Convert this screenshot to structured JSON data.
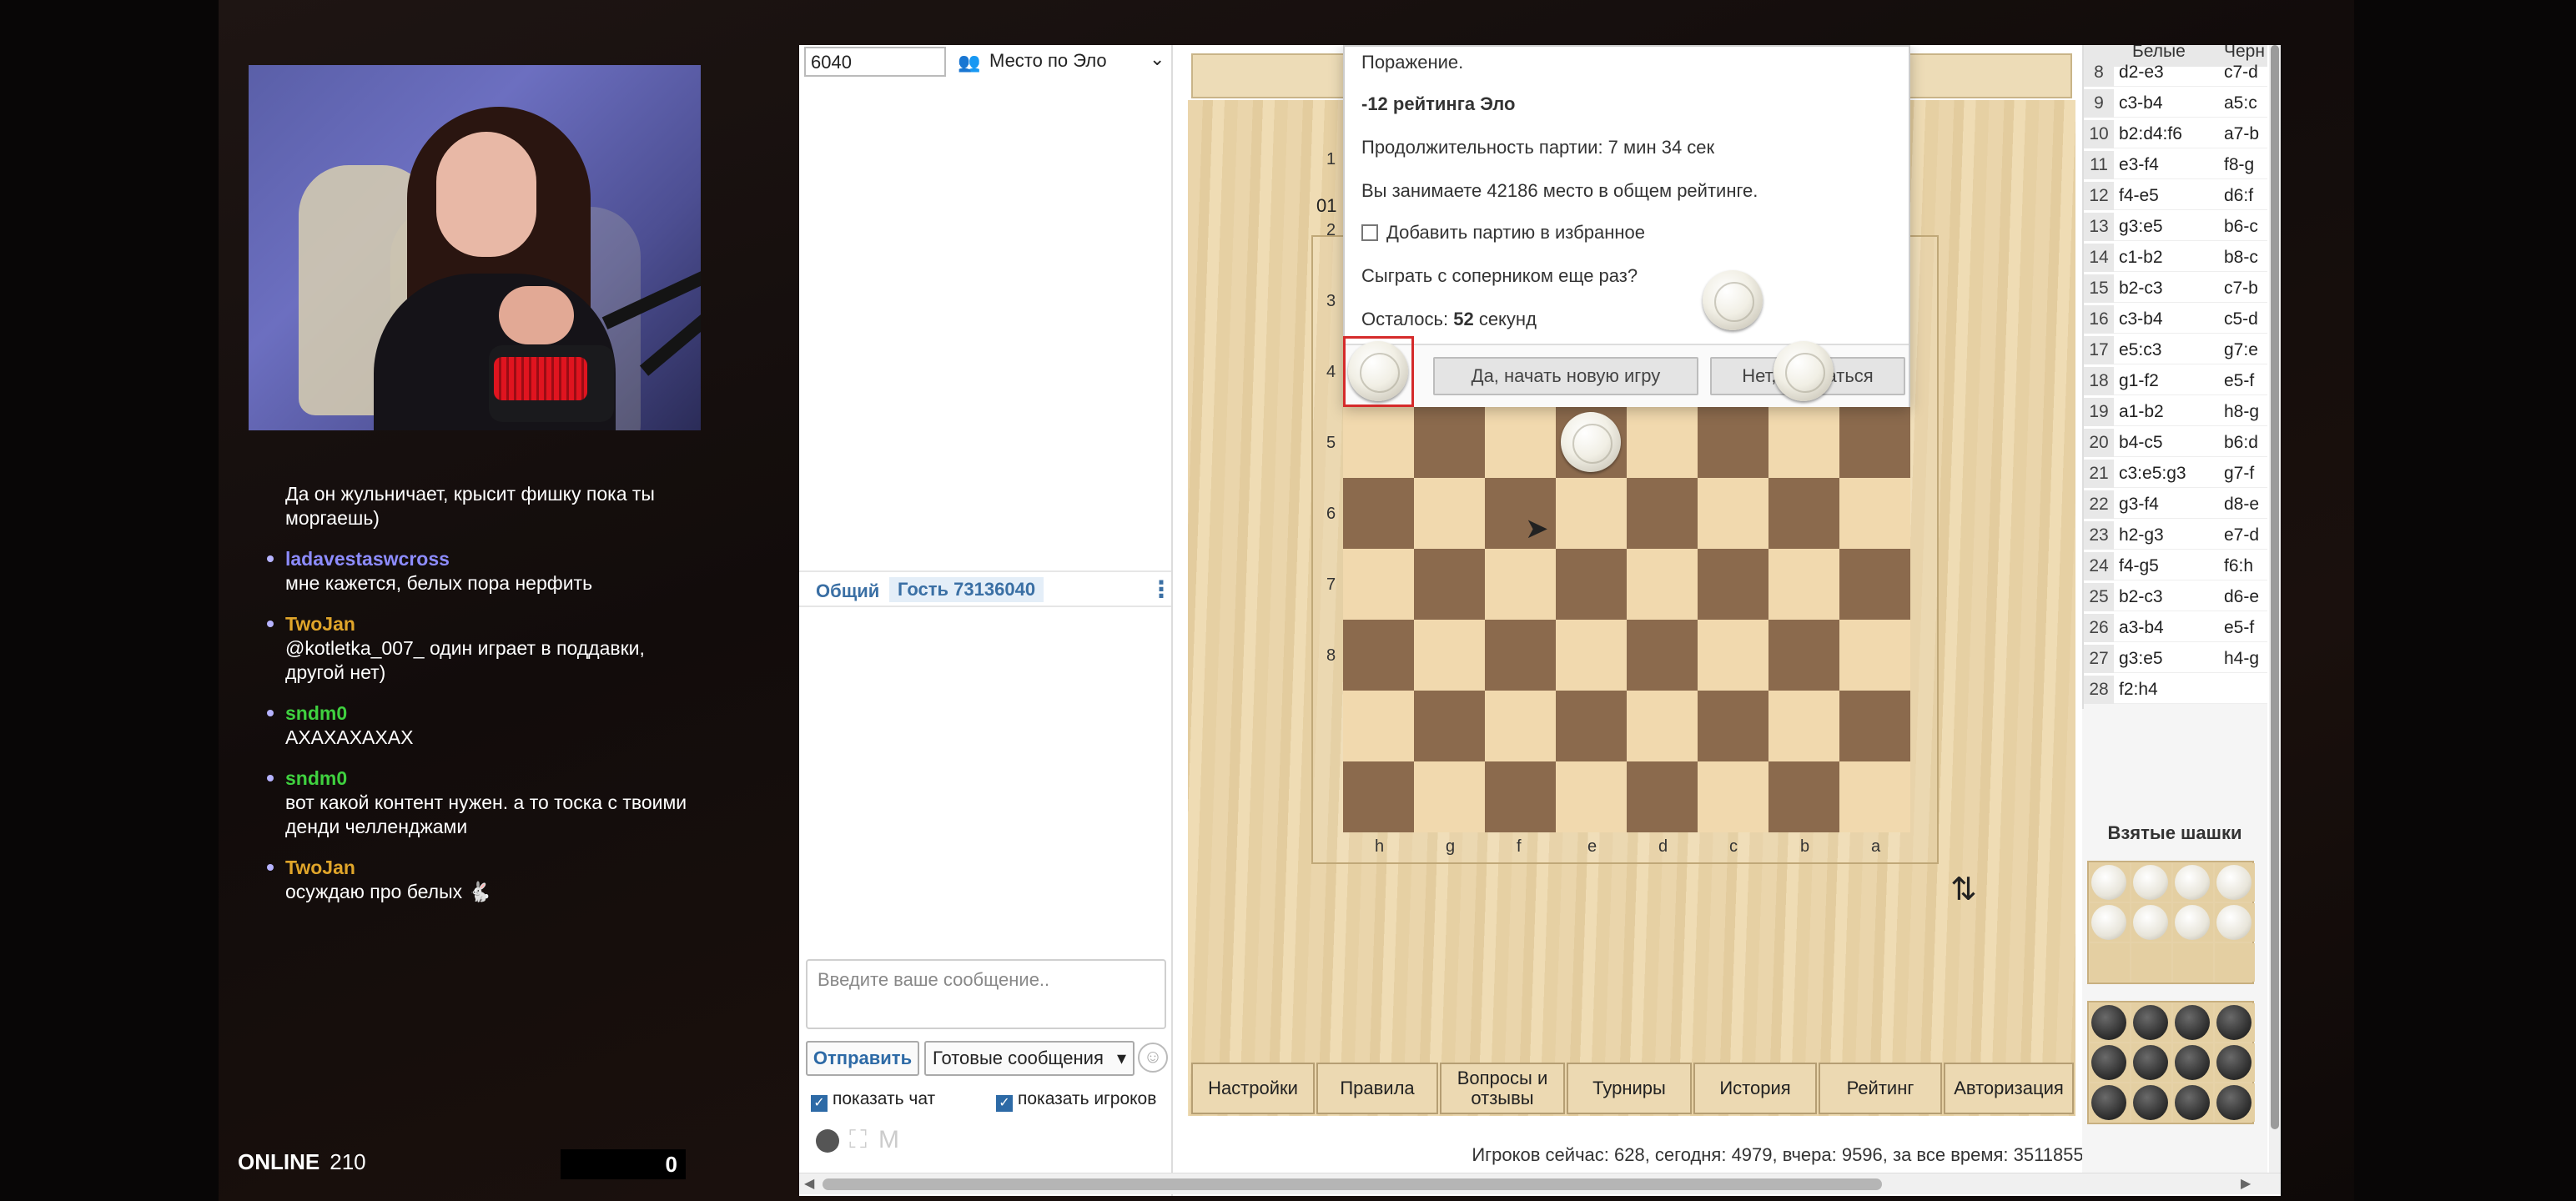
{
  "overlay": {
    "chat": [
      {
        "user": "",
        "text": "Да он жульничает, крысит фишку пока ты моргаешь)",
        "color": "#ffffff"
      },
      {
        "user": "ladavestaswcross",
        "text": "мне кажется, белых пора нерфить",
        "color": "#8d8cff"
      },
      {
        "user": "TwoJan",
        "text": "@kotletka_007_ один играет в поддавки, другой нет)",
        "color": "#e0a52a"
      },
      {
        "user": "sndm0",
        "text": "АХАХАХАХАХ",
        "color": "#3fd13f"
      },
      {
        "user": "sndm0",
        "text": "вот какой контент нужен. а то тоска с твоими денди челленджами",
        "color": "#3fd13f"
      },
      {
        "user": "TwoJan",
        "text": "осуждаю про белых 🐇",
        "color": "#e0a52a"
      }
    ],
    "online_label": "ONLINE",
    "online_count": "210",
    "counter": "0"
  },
  "left_panel": {
    "elo_input": "6040",
    "elo_select": "Место по Эло",
    "tabs": [
      "Общий",
      "Гость 73136040"
    ],
    "chat_placeholder": "Введите ваше сообщение..",
    "send": "Отправить",
    "ready_messages": "Готовые сообщения",
    "show_chat": "показать чат",
    "show_players": "показать игроков",
    "icon_m": "M"
  },
  "modal": {
    "result": "Поражение.",
    "rating": "-12 рейтинга Эло",
    "duration": "Продолжительность партии: 7 мин 34 сек",
    "place": "Вы занимаете 42186 место в общем рейтинге.",
    "favorite": "Добавить партию в избранное",
    "rematch": "Сыграть с соперником еще раз?",
    "remaining_label": "Осталось:",
    "remaining_value": "52",
    "remaining_unit": "секунд",
    "yes": "Да, начать новую игру",
    "no": "Нет, отказаться"
  },
  "board": {
    "partial_label": "01",
    "ranks": [
      "1",
      "2",
      "3",
      "4",
      "5",
      "6",
      "7",
      "8"
    ],
    "files": [
      "h",
      "g",
      "f",
      "e",
      "d",
      "c",
      "b",
      "a"
    ],
    "white_pieces": [
      {
        "rank": "3",
        "file": "c"
      },
      {
        "rank": "4",
        "file": "h",
        "selected": true
      },
      {
        "rank": "4",
        "file": "b"
      },
      {
        "rank": "5",
        "file": "e"
      }
    ],
    "light_color": "#f1d9ae",
    "dark_color": "#8b6a4d"
  },
  "nav": [
    "Настройки",
    "Правила",
    "Вопросы и отзывы",
    "Турниры",
    "История",
    "Рейтинг",
    "Авторизация"
  ],
  "footer": "Игроков сейчас: 628, сегодня: 4979, вчера: 9596, за все время: 3511855",
  "moves": {
    "header_white": "Белые",
    "header_black": "Черн",
    "rows": [
      {
        "n": "8",
        "w": "d2-e3",
        "b": "c7-d"
      },
      {
        "n": "9",
        "w": "c3-b4",
        "b": "a5:c"
      },
      {
        "n": "10",
        "w": "b2:d4:f6",
        "b": "a7-b"
      },
      {
        "n": "11",
        "w": "e3-f4",
        "b": "f8-g"
      },
      {
        "n": "12",
        "w": "f4-e5",
        "b": "d6:f"
      },
      {
        "n": "13",
        "w": "g3:e5",
        "b": "b6-c"
      },
      {
        "n": "14",
        "w": "c1-b2",
        "b": "b8-c"
      },
      {
        "n": "15",
        "w": "b2-c3",
        "b": "c7-b"
      },
      {
        "n": "16",
        "w": "c3-b4",
        "b": "c5-d"
      },
      {
        "n": "17",
        "w": "e5:c3",
        "b": "g7:e"
      },
      {
        "n": "18",
        "w": "g1-f2",
        "b": "e5-f"
      },
      {
        "n": "19",
        "w": "a1-b2",
        "b": "h8-g"
      },
      {
        "n": "20",
        "w": "b4-c5",
        "b": "b6:d"
      },
      {
        "n": "21",
        "w": "c3:e5:g3",
        "b": "g7-f"
      },
      {
        "n": "22",
        "w": "g3-f4",
        "b": "d8-e"
      },
      {
        "n": "23",
        "w": "h2-g3",
        "b": "e7-d"
      },
      {
        "n": "24",
        "w": "f4-g5",
        "b": "f6:h"
      },
      {
        "n": "25",
        "w": "b2-c3",
        "b": "d6-e"
      },
      {
        "n": "26",
        "w": "a3-b4",
        "b": "e5-f"
      },
      {
        "n": "27",
        "w": "g3:e5",
        "b": "h4-g"
      },
      {
        "n": "28",
        "w": "f2:h4",
        "b": ""
      }
    ],
    "taken_title": "Взятые шашки",
    "taken_white": 8,
    "taken_black": 12
  }
}
